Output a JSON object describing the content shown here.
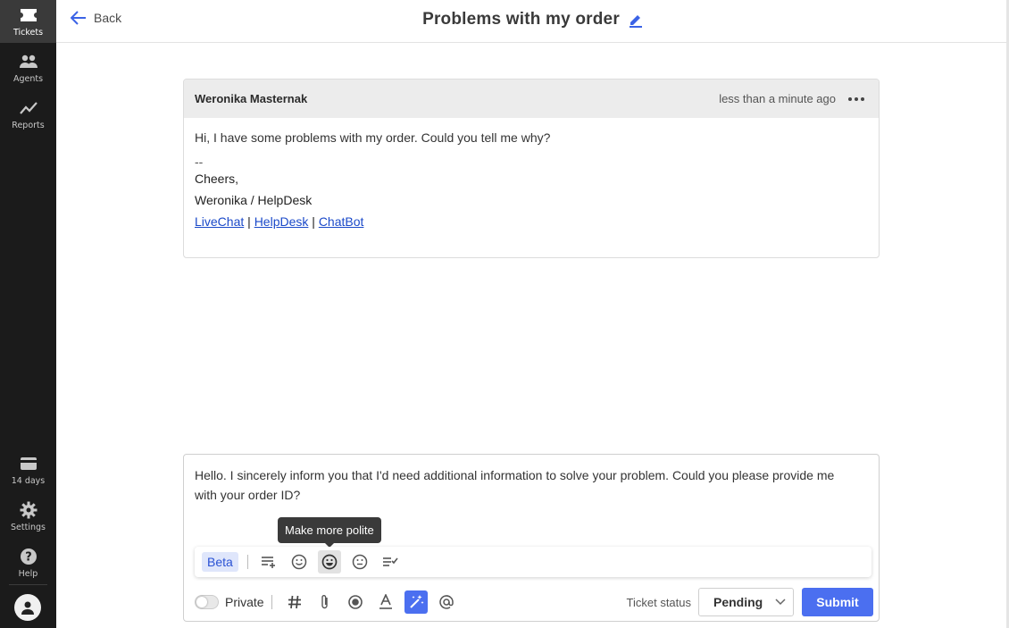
{
  "sidebar": {
    "items": [
      {
        "label": "Tickets",
        "icon": "tickets-icon"
      },
      {
        "label": "Agents",
        "icon": "agents-icon"
      },
      {
        "label": "Reports",
        "icon": "reports-icon"
      }
    ],
    "bottom": [
      {
        "label": "14 days",
        "icon": "trial-card-icon"
      },
      {
        "label": "Settings",
        "icon": "gear-icon"
      },
      {
        "label": "Help",
        "icon": "help-icon"
      }
    ]
  },
  "header": {
    "back_label": "Back",
    "title": "Problems with my order"
  },
  "message": {
    "author": "Weronika Masternak",
    "time": "less than a minute ago",
    "body": "Hi, I have some problems with my order. Could you tell me why?",
    "sig_dash": "--",
    "sig_line1": "Cheers,",
    "sig_line2": "Weronika / HelpDesk",
    "links": [
      "LiveChat",
      "HelpDesk",
      "ChatBot"
    ],
    "link_sep": "|"
  },
  "composer": {
    "text": "Hello. I sincerely inform you that I'd need additional information to solve your problem. Could you please provide me with your order ID?",
    "tooltip": "Make more polite",
    "beta_label": "Beta",
    "private_label": "Private",
    "ticket_status_label": "Ticket status",
    "status_value": "Pending",
    "submit_label": "Submit"
  },
  "colors": {
    "accent": "#4b6ff0",
    "sidebar_bg": "#1b1b1b",
    "link": "#1a49c9"
  }
}
